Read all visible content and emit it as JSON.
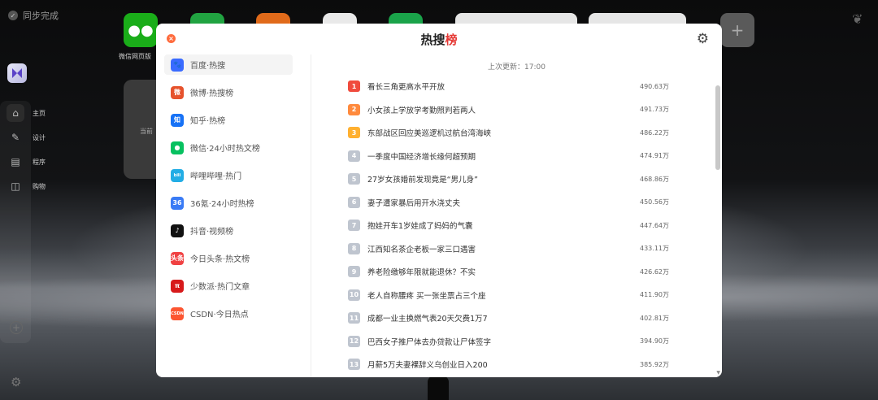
{
  "desktop": {
    "sync_label": "同步完成",
    "rail": [
      {
        "label": "主页",
        "icon": "home-icon"
      },
      {
        "label": "设计",
        "icon": "design-icon"
      },
      {
        "label": "程序",
        "icon": "program-icon"
      },
      {
        "label": "购物",
        "icon": "shopping-icon"
      }
    ],
    "tile_label": "微信网页版",
    "bg_card_text": "当前"
  },
  "modal": {
    "title_part1": "热搜",
    "title_part2": "榜",
    "accent_color": "#e53935",
    "updated": "上次更新：17:00",
    "sources": [
      {
        "label": "百度·热搜",
        "icon": "baidu-icon",
        "glyph": "🐾",
        "color": "#3a6bff",
        "active": true
      },
      {
        "label": "微博·热搜榜",
        "icon": "weibo-icon",
        "glyph": "微",
        "color": "#e6522c"
      },
      {
        "label": "知乎·热榜",
        "icon": "zhihu-icon",
        "glyph": "知",
        "color": "#1772f6"
      },
      {
        "label": "微信·24小时热文榜",
        "icon": "wechat-icon",
        "glyph": "●",
        "color": "#07c160"
      },
      {
        "label": "哔哩哔哩·热门",
        "icon": "bilibili-icon",
        "glyph": "bili",
        "color": "#23ade5"
      },
      {
        "label": "36氪·24小时热榜",
        "icon": "36kr-icon",
        "glyph": "36",
        "color": "#3a7bf5"
      },
      {
        "label": "抖音·视频榜",
        "icon": "douyin-icon",
        "glyph": "♪",
        "color": "#111111"
      },
      {
        "label": "今日头条·热文榜",
        "icon": "toutiao-icon",
        "glyph": "头条",
        "color": "#f04142"
      },
      {
        "label": "少数派·热门文章",
        "icon": "sspai-icon",
        "glyph": "π",
        "color": "#d71a1b"
      },
      {
        "label": "CSDN·今日热点",
        "icon": "csdn-icon",
        "glyph": "CSDN",
        "color": "#fc5531"
      }
    ],
    "items": [
      {
        "rank": "1",
        "title": "看长三角更高水平开放",
        "heat": "490.63万"
      },
      {
        "rank": "2",
        "title": "小女孩上学放学考勤照判若两人",
        "heat": "491.73万"
      },
      {
        "rank": "3",
        "title": "东部战区回应美巡逻机过航台湾海峡",
        "heat": "486.22万"
      },
      {
        "rank": "4",
        "title": "一季度中国经济增长缘何超预期",
        "heat": "474.91万"
      },
      {
        "rank": "5",
        "title": "27岁女孩婚前发现竟是“男儿身”",
        "heat": "468.86万"
      },
      {
        "rank": "6",
        "title": "妻子遭家暴后用开水浇丈夫",
        "heat": "450.56万"
      },
      {
        "rank": "7",
        "title": "抱娃开车1岁娃成了妈妈的气囊",
        "heat": "447.64万"
      },
      {
        "rank": "8",
        "title": "江西知名茶企老板一家三口遇害",
        "heat": "433.11万"
      },
      {
        "rank": "9",
        "title": "养老险缴够年限就能退休？不实",
        "heat": "426.62万"
      },
      {
        "rank": "10",
        "title": "老人自称腰疼 买一张坐票占三个座",
        "heat": "411.90万"
      },
      {
        "rank": "11",
        "title": "成都一业主换燃气表20天欠费1万7",
        "heat": "402.81万"
      },
      {
        "rank": "12",
        "title": "巴西女子推尸体去办贷款让尸体签字",
        "heat": "394.90万"
      },
      {
        "rank": "13",
        "title": "月薪5万夫妻裸辞义乌创业日入200",
        "heat": "385.92万"
      }
    ],
    "rank_colors": {
      "1": "#f04b3d",
      "2": "#ff8a3d",
      "3": "#ffb030",
      "other": "#bfc5cf"
    }
  }
}
